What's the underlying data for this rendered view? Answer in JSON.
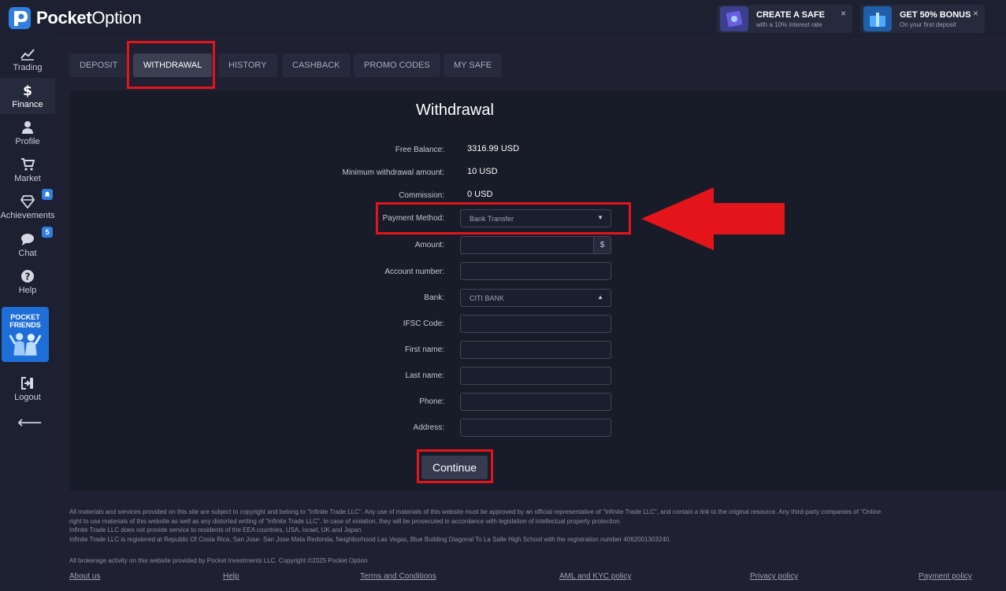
{
  "brand": {
    "name_bold": "Pocket",
    "name_light": "Option"
  },
  "promos": [
    {
      "title": "CREATE A SAFE",
      "subtitle": "with a 10% interest rate",
      "close": "×"
    },
    {
      "title": "GET 50% BONUS",
      "subtitle": "On your first deposit",
      "close": "×"
    }
  ],
  "sidebar": {
    "items": [
      {
        "label": "Trading",
        "icon": "chart-line-icon"
      },
      {
        "label": "Finance",
        "icon": "dollar-icon"
      },
      {
        "label": "Profile",
        "icon": "user-icon"
      },
      {
        "label": "Market",
        "icon": "cart-icon"
      },
      {
        "label": "Achievements",
        "icon": "diamond-icon"
      },
      {
        "label": "Chat",
        "icon": "chat-icon",
        "badge": "5"
      },
      {
        "label": "Help",
        "icon": "help-icon"
      },
      {
        "label": "Logout",
        "icon": "logout-icon"
      }
    ],
    "friends_title_1": "POCKET",
    "friends_title_2": "FRIENDS",
    "back": "⟵"
  },
  "tabs": [
    "DEPOSIT",
    "WITHDRAWAL",
    "HISTORY",
    "CASHBACK",
    "PROMO CODES",
    "MY SAFE"
  ],
  "form": {
    "title": "Withdrawal",
    "free_balance_label": "Free Balance:",
    "free_balance_value": "3316.99 USD",
    "min_label": "Minimum withdrawal amount:",
    "min_value": "10 USD",
    "commission_label": "Commission:",
    "commission_value": "0 USD",
    "payment_method_label": "Payment Method:",
    "payment_method_value": "Bank Transfer",
    "amount_label": "Amount:",
    "amount_currency": "$",
    "account_label": "Account number:",
    "bank_label": "Bank:",
    "bank_value": "CITI BANK",
    "ifsc_label": "IFSC Code:",
    "first_name_label": "First name:",
    "last_name_label": "Last name:",
    "phone_label": "Phone:",
    "address_label": "Address:",
    "continue": "Continue"
  },
  "footer": {
    "line1": "All materials and services provided on this site are subject to copyright and belong to \"Infinite Trade LLC\". Any use of materials of this website must be approved by an official representative of \"Infinite Trade LLC\", and contain a link to the original resource. Any third-party companies of \"Online",
    "line2": "right to use materials of this website as well as any distorted writing of \"Infinite Trade LLC\". In case of violation, they will be prosecuted in accordance with legislation of intellectual property protection.",
    "line3": "Infinite Trade LLC does not provide service to residents of the EEA countries, USA, Israel, UK and Japan.",
    "line4": "Infinite Trade LLC is registered at Republic Of Costa Rica, San Jose- San Jose Mata Redonda, Neighborhood Las Vegas, Blue Building Diagonal To La Salle High School with the registration number 4062001303240.",
    "copyright": "All brokerage activity on this website provided by Pocket Investments LLC. Copyright ©2025 Pocket Option",
    "links": [
      "About us",
      "Help",
      "Terms and Conditions",
      "AML and KYC policy",
      "Privacy policy",
      "Payment policy"
    ]
  },
  "colors": {
    "accent_blue": "#2f7fe0",
    "highlight_red": "#e4141b",
    "panel": "#181b28",
    "background": "#1f2132"
  }
}
